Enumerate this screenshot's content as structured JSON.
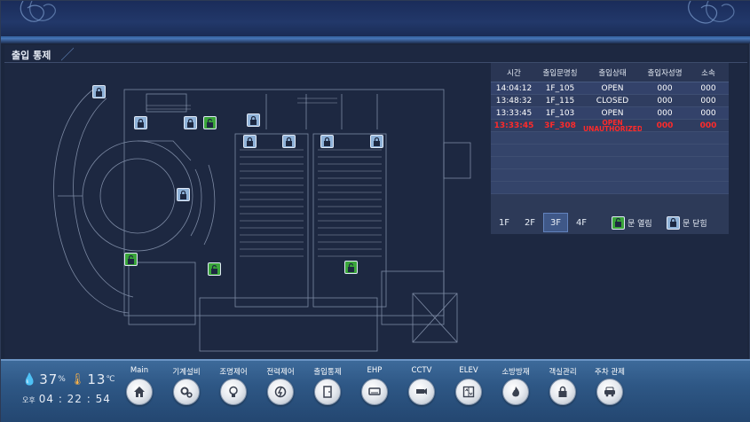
{
  "panel": {
    "title": "출입 통제"
  },
  "access_log": {
    "headers": [
      "시간",
      "출입문명칭",
      "출입상태",
      "출입자성명",
      "소속"
    ],
    "rows": [
      {
        "time": "14:04:12",
        "door": "1F_105",
        "status": "OPEN",
        "name": "000",
        "dept": "000",
        "alarm": false
      },
      {
        "time": "13:48:32",
        "door": "1F_115",
        "status": "CLOSED",
        "name": "000",
        "dept": "000",
        "alarm": false
      },
      {
        "time": "13:33:45",
        "door": "1F_103",
        "status": "OPEN",
        "name": "000",
        "dept": "000",
        "alarm": false
      },
      {
        "time": "13:33:45",
        "door": "3F_308",
        "status": "OPEN UNAUTHORIZED",
        "name": "000",
        "dept": "000",
        "alarm": true
      }
    ],
    "empty_rows": 5
  },
  "floors": {
    "buttons": [
      "1F",
      "2F",
      "3F",
      "4F"
    ],
    "selected": "3F"
  },
  "legend": {
    "open_label": "문 열림",
    "closed_label": "문 닫힘"
  },
  "weather": {
    "humidity": "37",
    "humidity_unit": "%",
    "temperature": "13",
    "temperature_unit": "℃"
  },
  "clock": {
    "ampm": "오후",
    "time": "04 : 22 : 54"
  },
  "nav": [
    {
      "label": "Main",
      "icon": "home-icon"
    },
    {
      "label": "기계설비",
      "icon": "gears-icon"
    },
    {
      "label": "조명제어",
      "icon": "bulb-icon"
    },
    {
      "label": "전력제어",
      "icon": "power-icon"
    },
    {
      "label": "출입통제",
      "icon": "door-icon"
    },
    {
      "label": "EHP",
      "icon": "aircon-icon"
    },
    {
      "label": "CCTV",
      "icon": "camera-icon"
    },
    {
      "label": "ELEV",
      "icon": "elevator-icon"
    },
    {
      "label": "소방방재",
      "icon": "fire-icon"
    },
    {
      "label": "객실관리",
      "icon": "room-lock-icon"
    },
    {
      "label": "주차 관제",
      "icon": "parking-icon"
    }
  ],
  "colors": {
    "accent": "#3b6aa8",
    "alarm": "#ff2a2a",
    "door_open": "#3aa53a",
    "door_closed": "#8fb2d8"
  }
}
